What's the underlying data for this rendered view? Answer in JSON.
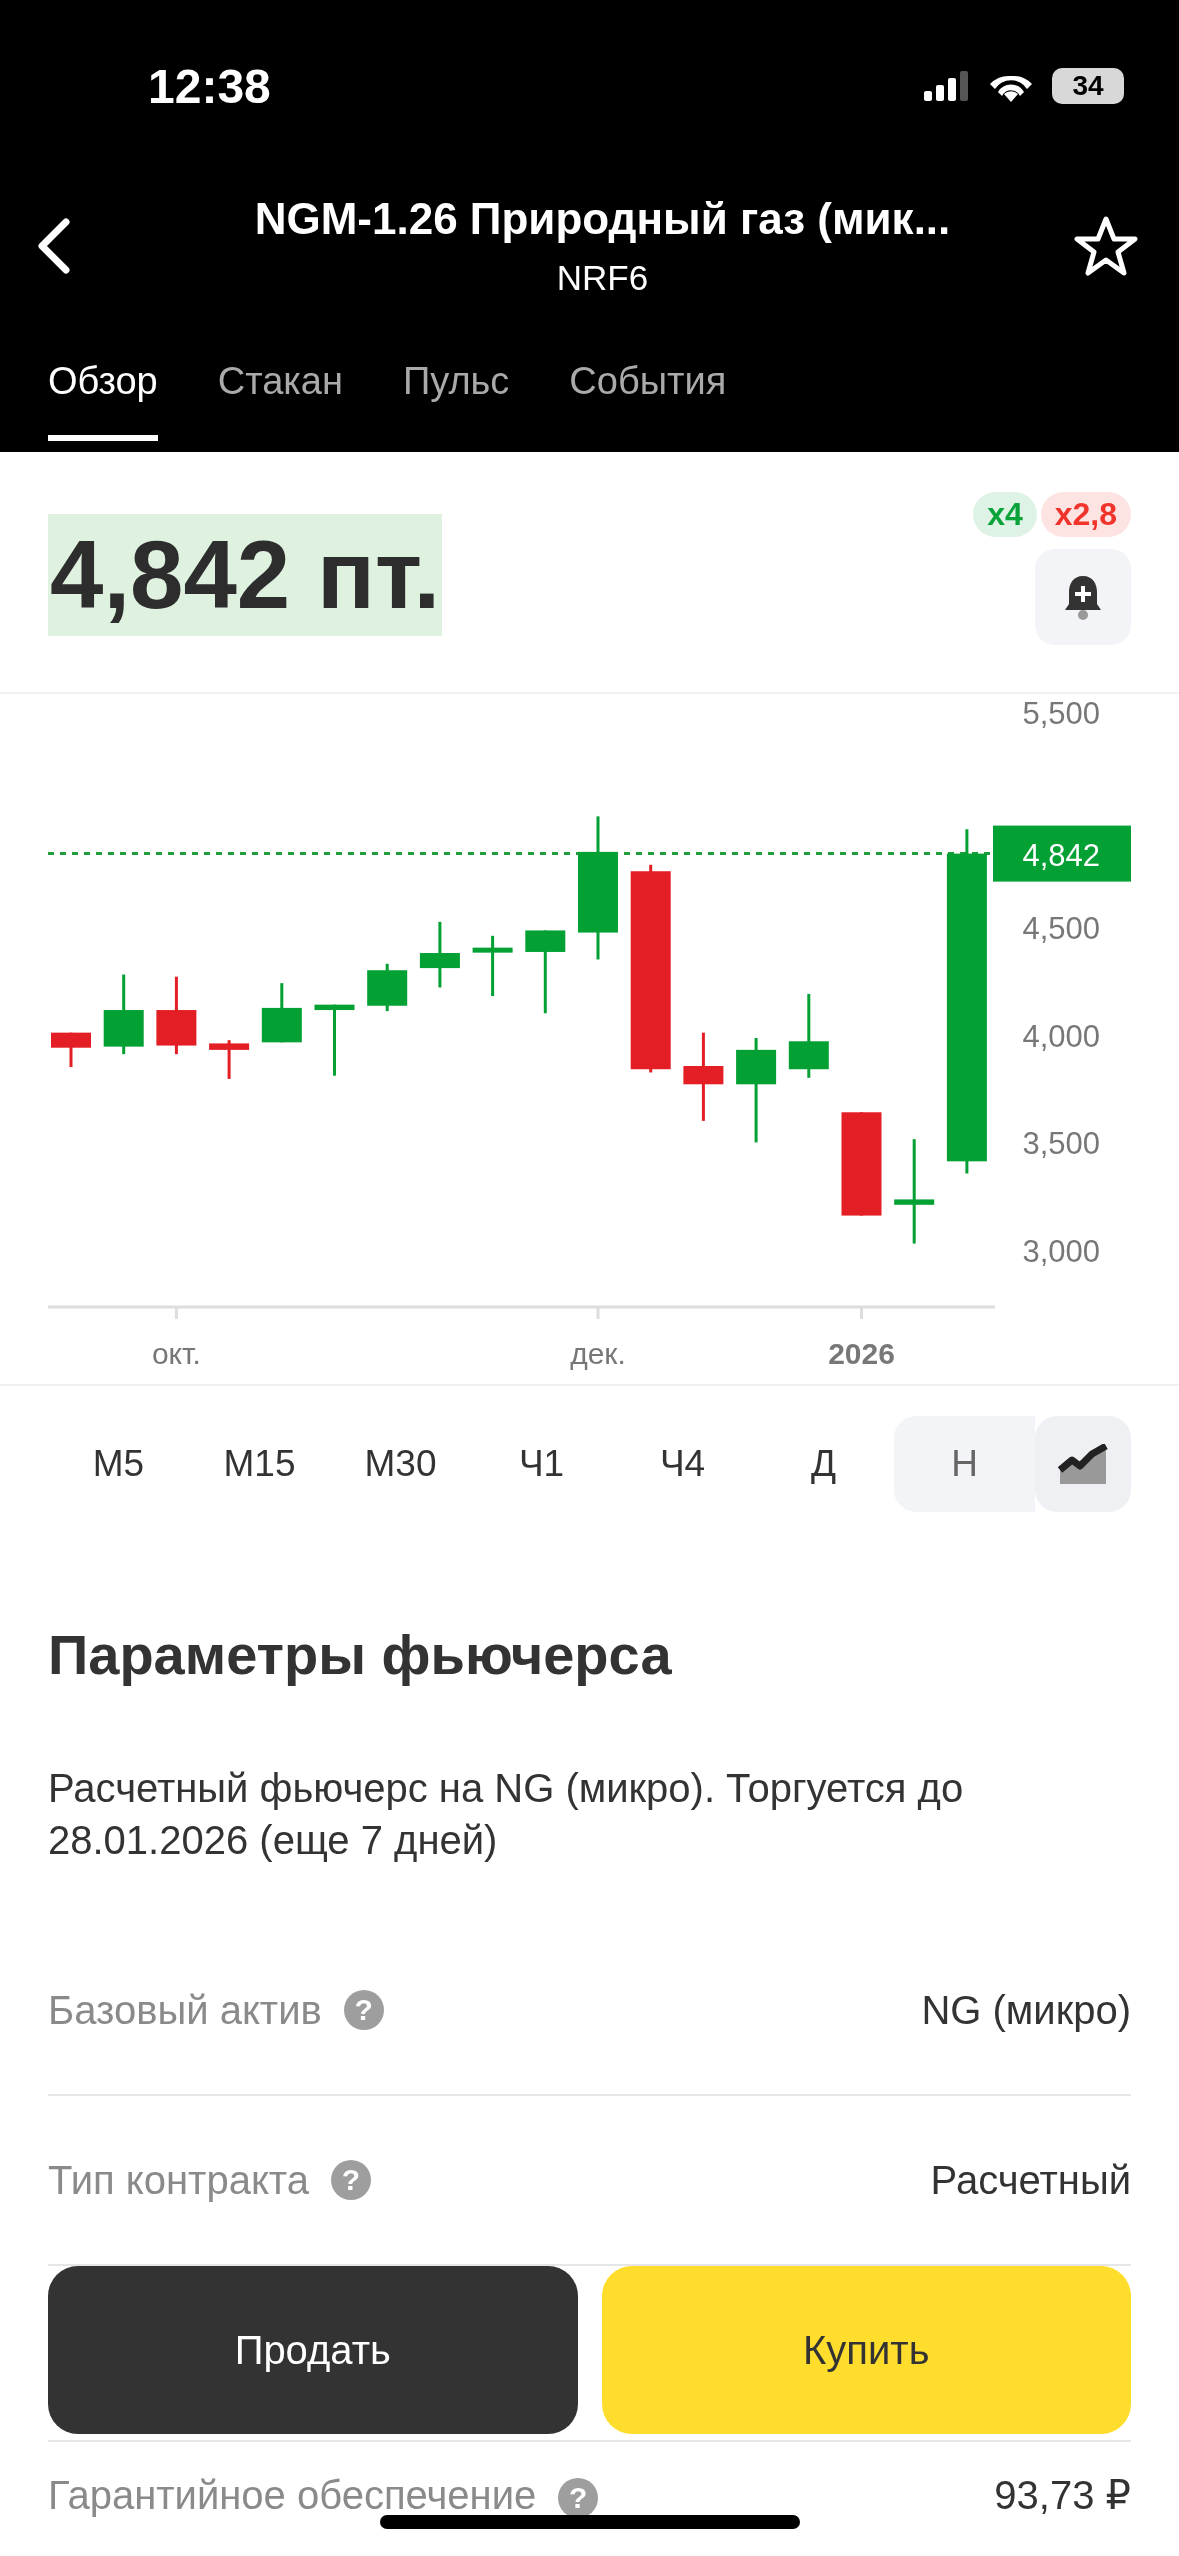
{
  "status_bar": {
    "time": "12:38",
    "battery": "34"
  },
  "header": {
    "title": "NGM-1.26 Природный газ (мик...",
    "subtitle": "NRF6",
    "favorite": false
  },
  "tabs": [
    {
      "label": "Обзор",
      "selected": true
    },
    {
      "label": "Стакан",
      "selected": false
    },
    {
      "label": "Пульс",
      "selected": false
    },
    {
      "label": "События",
      "selected": false
    }
  ],
  "price": {
    "value": "4,842 пт.",
    "badges": [
      {
        "label": "x4",
        "color": "#0aa33a"
      },
      {
        "label": "x2,8",
        "color": "#f0342c"
      }
    ]
  },
  "chart": {
    "price_tag": "4,842",
    "y_labels": [
      "5,500",
      "4,500",
      "4,000",
      "3,500",
      "3,000"
    ],
    "x_labels": [
      "окт.",
      "дек.",
      "2026"
    ]
  },
  "timeframes": [
    {
      "label": "M5",
      "selected": false
    },
    {
      "label": "М15",
      "selected": false
    },
    {
      "label": "M30",
      "selected": false
    },
    {
      "label": "Ч1",
      "selected": false
    },
    {
      "label": "Ч4",
      "selected": false
    },
    {
      "label": "Д",
      "selected": false
    },
    {
      "label": "Н",
      "selected": true
    }
  ],
  "section": {
    "title": "Параметры фьючерса",
    "description": "Расчетный фьючерс на NG (микро). Торгуется до 28.01.2026 (еще 7 дней)"
  },
  "params": [
    {
      "label": "Базовый актив",
      "help": "?",
      "value": "NG (микро)"
    },
    {
      "label": "Тип контракта",
      "help": "?",
      "value": "Расчетный"
    }
  ],
  "actions": [
    {
      "label": "Продать",
      "kind": "sell"
    },
    {
      "label": "Купить",
      "kind": "buy"
    }
  ],
  "params_after": [
    {
      "label": "Гарантийное обеспечение",
      "help": "?",
      "value": "93,73 ₽"
    }
  ]
}
